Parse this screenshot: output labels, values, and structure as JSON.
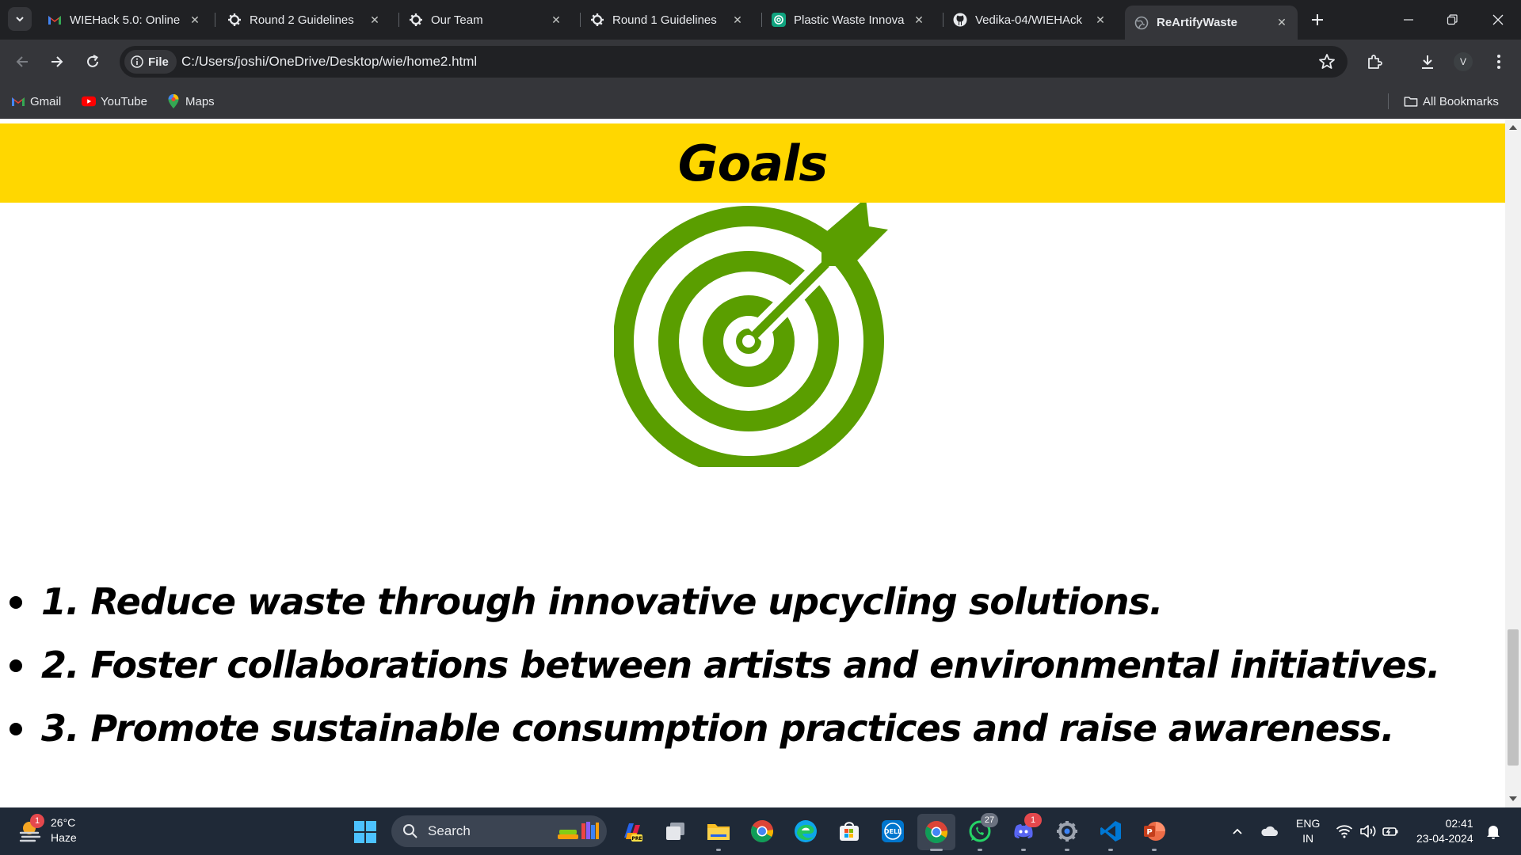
{
  "browser": {
    "tabs": [
      {
        "title": "WIEHack 5.0: Online",
        "icon": "gmail-icon",
        "active": false
      },
      {
        "title": "Round 2 Guidelines",
        "icon": "gear-icon",
        "active": false
      },
      {
        "title": "Our Team",
        "icon": "gear-icon",
        "active": false
      },
      {
        "title": "Round 1 Guidelines",
        "icon": "gear-icon",
        "active": false
      },
      {
        "title": "Plastic Waste Innova",
        "icon": "chatgpt-icon",
        "active": false
      },
      {
        "title": "Vedika-04/WIEHAck",
        "icon": "github-icon",
        "active": false
      },
      {
        "title": "ReArtifyWaste",
        "icon": "globe-icon",
        "active": true
      }
    ],
    "address": {
      "scheme_label": "File",
      "url": "C:/Users/joshi/OneDrive/Desktop/wie/home2.html"
    },
    "profile_initial": "V",
    "bookmarks": [
      {
        "label": "Gmail",
        "icon": "gmail-icon"
      },
      {
        "label": "YouTube",
        "icon": "youtube-icon"
      },
      {
        "label": "Maps",
        "icon": "maps-icon"
      }
    ],
    "all_bookmarks_label": "All Bookmarks"
  },
  "page": {
    "banner_title": "Goals",
    "banner_color": "#ffd700",
    "target_color": "#5a9e00",
    "goals": [
      "1. Reduce waste through innovative upcycling solutions.",
      "2. Foster collaborations between artists and environmental initiatives.",
      "3. Promote sustainable consumption practices and raise awareness."
    ]
  },
  "taskbar": {
    "weather": {
      "temp": "26°C",
      "condition": "Haze",
      "badge": "1"
    },
    "search_placeholder": "Search",
    "apps": [
      {
        "name": "copilot",
        "badge": ""
      },
      {
        "name": "task-view",
        "badge": ""
      },
      {
        "name": "file-explorer",
        "badge": ""
      },
      {
        "name": "chrome",
        "badge": ""
      },
      {
        "name": "edge",
        "badge": ""
      },
      {
        "name": "microsoft-store",
        "badge": ""
      },
      {
        "name": "dell",
        "badge": ""
      },
      {
        "name": "chrome-active",
        "badge": ""
      },
      {
        "name": "whatsapp",
        "badge": "27"
      },
      {
        "name": "discord",
        "badge": "1"
      },
      {
        "name": "settings",
        "badge": ""
      },
      {
        "name": "vscode",
        "badge": ""
      },
      {
        "name": "powerpoint",
        "badge": ""
      }
    ],
    "language": {
      "line1": "ENG",
      "line2": "IN"
    },
    "clock": {
      "time": "02:41",
      "date": "23-04-2024"
    }
  }
}
